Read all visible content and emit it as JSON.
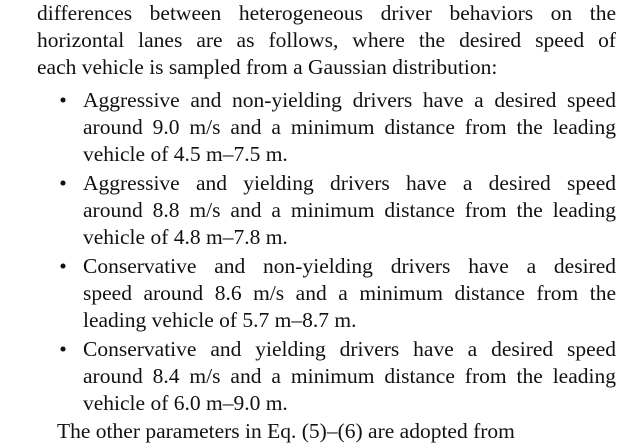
{
  "intro": {
    "lines": [
      "differences between heterogeneous driver behaviors on the",
      "horizontal lanes are as follows, where the desired speed of",
      "each vehicle is sampled from a Gaussian distribution:"
    ]
  },
  "bullet_symbol": "•",
  "bullets": [
    {
      "lines": [
        "Aggressive and non-yielding drivers have a desired speed",
        "around 9.0 m/s and a minimum distance from the leading",
        "vehicle of 4.5 m–7.5 m."
      ]
    },
    {
      "lines": [
        "Aggressive and yielding drivers have a desired speed",
        "around 8.8 m/s and a minimum distance from the leading",
        "vehicle of 4.8 m–7.8 m."
      ]
    },
    {
      "lines": [
        "Conservative and non-yielding drivers have a desired",
        "speed around 8.6 m/s and a minimum distance from the",
        "leading vehicle of 5.7 m–8.7 m."
      ]
    },
    {
      "lines": [
        "Conservative and yielding drivers have a desired speed",
        "around 8.4 m/s and a minimum distance from the leading",
        "vehicle of 6.0 m–9.0 m."
      ]
    }
  ],
  "next_paragraph_partial": "The other parameters in Eq. (5)–(6) are adopted from"
}
